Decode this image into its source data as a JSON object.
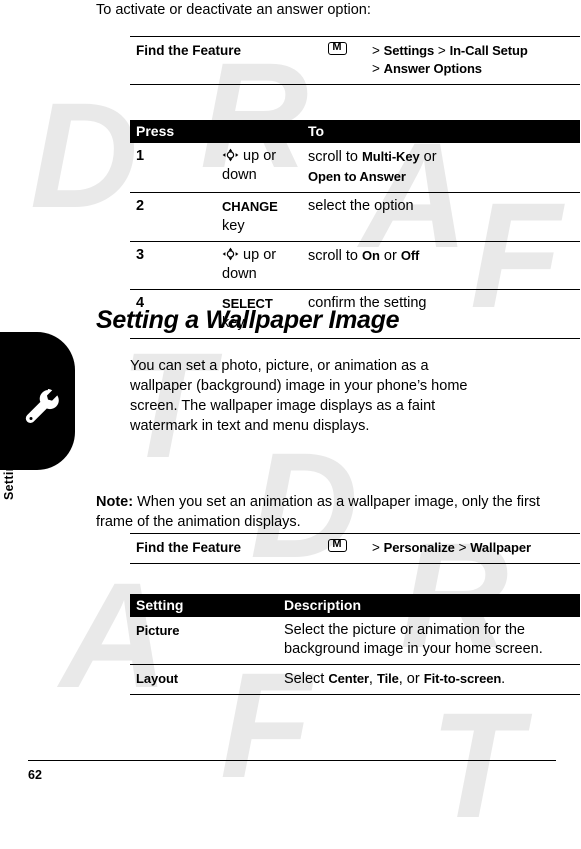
{
  "page": {
    "number": "62",
    "side_label": "Setting Up Your Phone",
    "tab_icon": "wrench-icon",
    "watermark": "DRAFT"
  },
  "intro": {
    "text": "To activate or deactivate an answer option:"
  },
  "find_feature_1": {
    "label": "Find the Feature",
    "key_icon": "menu-key-icon",
    "path_line1_prefix": ">",
    "path_line1_item1": "Settings",
    "path_line1_sep": ">",
    "path_line1_item2": "In-Call Setup",
    "path_line2_prefix": ">",
    "path_line2_item1": "Answer Options"
  },
  "steps_table": {
    "headers": [
      "Press",
      "To"
    ],
    "rows": [
      {
        "num": "1",
        "press_icon": "joystick-icon",
        "press": "up or down",
        "to_prefix": "scroll to ",
        "to_bold1": "Multi-Key",
        "to_mid": " or",
        "to_bold2": "Open to Answer"
      },
      {
        "num": "2",
        "press_bold": "CHANGE",
        "press_suffix": "key",
        "to": "select the option"
      },
      {
        "num": "3",
        "press_icon": "joystick-icon",
        "press": "up or down",
        "to_prefix": "scroll to ",
        "to_bold1": "On",
        "to_mid": " or ",
        "to_bold2": "Off"
      },
      {
        "num": "4",
        "press_bold": "SELECT",
        "press_suffix": "key",
        "to": "confirm the setting"
      }
    ]
  },
  "section": {
    "heading": "Setting a Wallpaper Image",
    "paragraph": "You can set a photo, picture, or animation as a wallpaper (background) image in your phone’s home screen. The wallpaper image displays as a faint watermark in text and menu displays.",
    "note_label": "Note:",
    "note_text": " When you set an animation as a wallpaper image, only the first frame of the animation displays."
  },
  "find_feature_2": {
    "label": "Find the Feature",
    "key_icon": "menu-key-icon",
    "path_prefix": ">",
    "path_item1": "Personalize",
    "path_sep": ">",
    "path_item2": "Wallpaper"
  },
  "settings_table": {
    "headers": [
      "Setting",
      "Description"
    ],
    "rows": [
      {
        "setting": "Picture",
        "description": "Select the picture or animation for the background image in your home screen."
      },
      {
        "setting": "Layout",
        "desc_prefix": "Select ",
        "desc_bold1": "Center",
        "desc_mid1": ", ",
        "desc_bold2": "Tile",
        "desc_mid2": ", or ",
        "desc_bold3": "Fit-to-screen",
        "desc_suffix": "."
      }
    ]
  }
}
